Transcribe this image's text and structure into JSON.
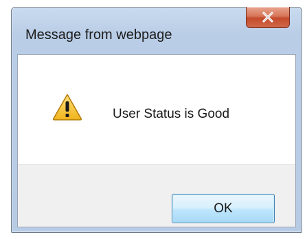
{
  "dialog": {
    "title": "Message from webpage",
    "message": "User Status is Good",
    "ok_label": "OK",
    "close_glyph": "X",
    "icon": "warning-icon"
  },
  "colors": {
    "close_button": "#c44a2c",
    "ok_button_border": "#3c7fb1",
    "warning_fill": "#f4c542",
    "footer_bg": "#f0f0f0"
  }
}
